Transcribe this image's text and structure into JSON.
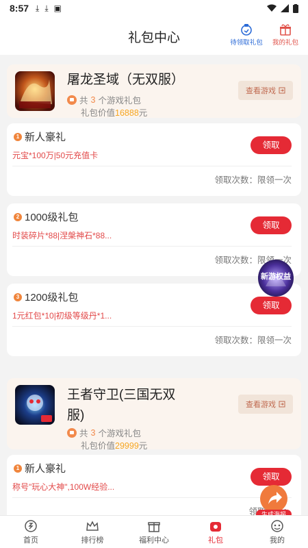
{
  "status": {
    "time": "8:57"
  },
  "header": {
    "title": "礼包中心",
    "claimable_label": "待领取礼包",
    "my_gifts_label": "我的礼包"
  },
  "games": [
    {
      "name_line1": "屠龙圣域（无双服）",
      "name_line2": "",
      "gift_count_prefix": "共",
      "gift_count": "3",
      "gift_count_suffix": "个游戏礼包",
      "value_prefix": "礼包价值",
      "value": "16888",
      "value_suffix": "元",
      "view_label": "查看游戏",
      "gifts": [
        {
          "rank": "1",
          "title": "新人豪礼",
          "desc": "元宝*100万|50元充值卡",
          "claim": "领取",
          "times": "领取次数：限领一次"
        },
        {
          "rank": "2",
          "title": "1000级礼包",
          "desc": "时装碎片*88|涅槃神石*88...",
          "claim": "领取",
          "times": "领取次数：限领一次"
        },
        {
          "rank": "3",
          "title": "1200级礼包",
          "desc": "1元红包*10|初级等级丹*1...",
          "claim": "领取",
          "times": "领取次数：限领一次"
        }
      ]
    },
    {
      "name_line1": "王者守卫(三国无双",
      "name_line2": "服)",
      "gift_count_prefix": "共",
      "gift_count": "3",
      "gift_count_suffix": "个游戏礼包",
      "value_prefix": "礼包价值",
      "value": "29999",
      "value_suffix": "元",
      "view_label": "查看游戏",
      "gifts": [
        {
          "rank": "1",
          "title": "新人豪礼",
          "desc": "称号\"玩心大神\",100W经验...",
          "claim": "领取",
          "times": "领取次数："
        }
      ]
    }
  ],
  "floating": {
    "new_game_label": "新游权益",
    "poster_label": "生成海报"
  },
  "tabs": [
    {
      "label": "首页",
      "icon": "home-icon"
    },
    {
      "label": "排行榜",
      "icon": "crown-icon"
    },
    {
      "label": "福利中心",
      "icon": "gift-box-icon"
    },
    {
      "label": "礼包",
      "icon": "gift-bag-icon",
      "active": true
    },
    {
      "label": "我的",
      "icon": "profile-icon"
    }
  ],
  "colors": {
    "accent": "#e52a35",
    "orange": "#f28a4c",
    "value_gold": "#f5a623"
  }
}
